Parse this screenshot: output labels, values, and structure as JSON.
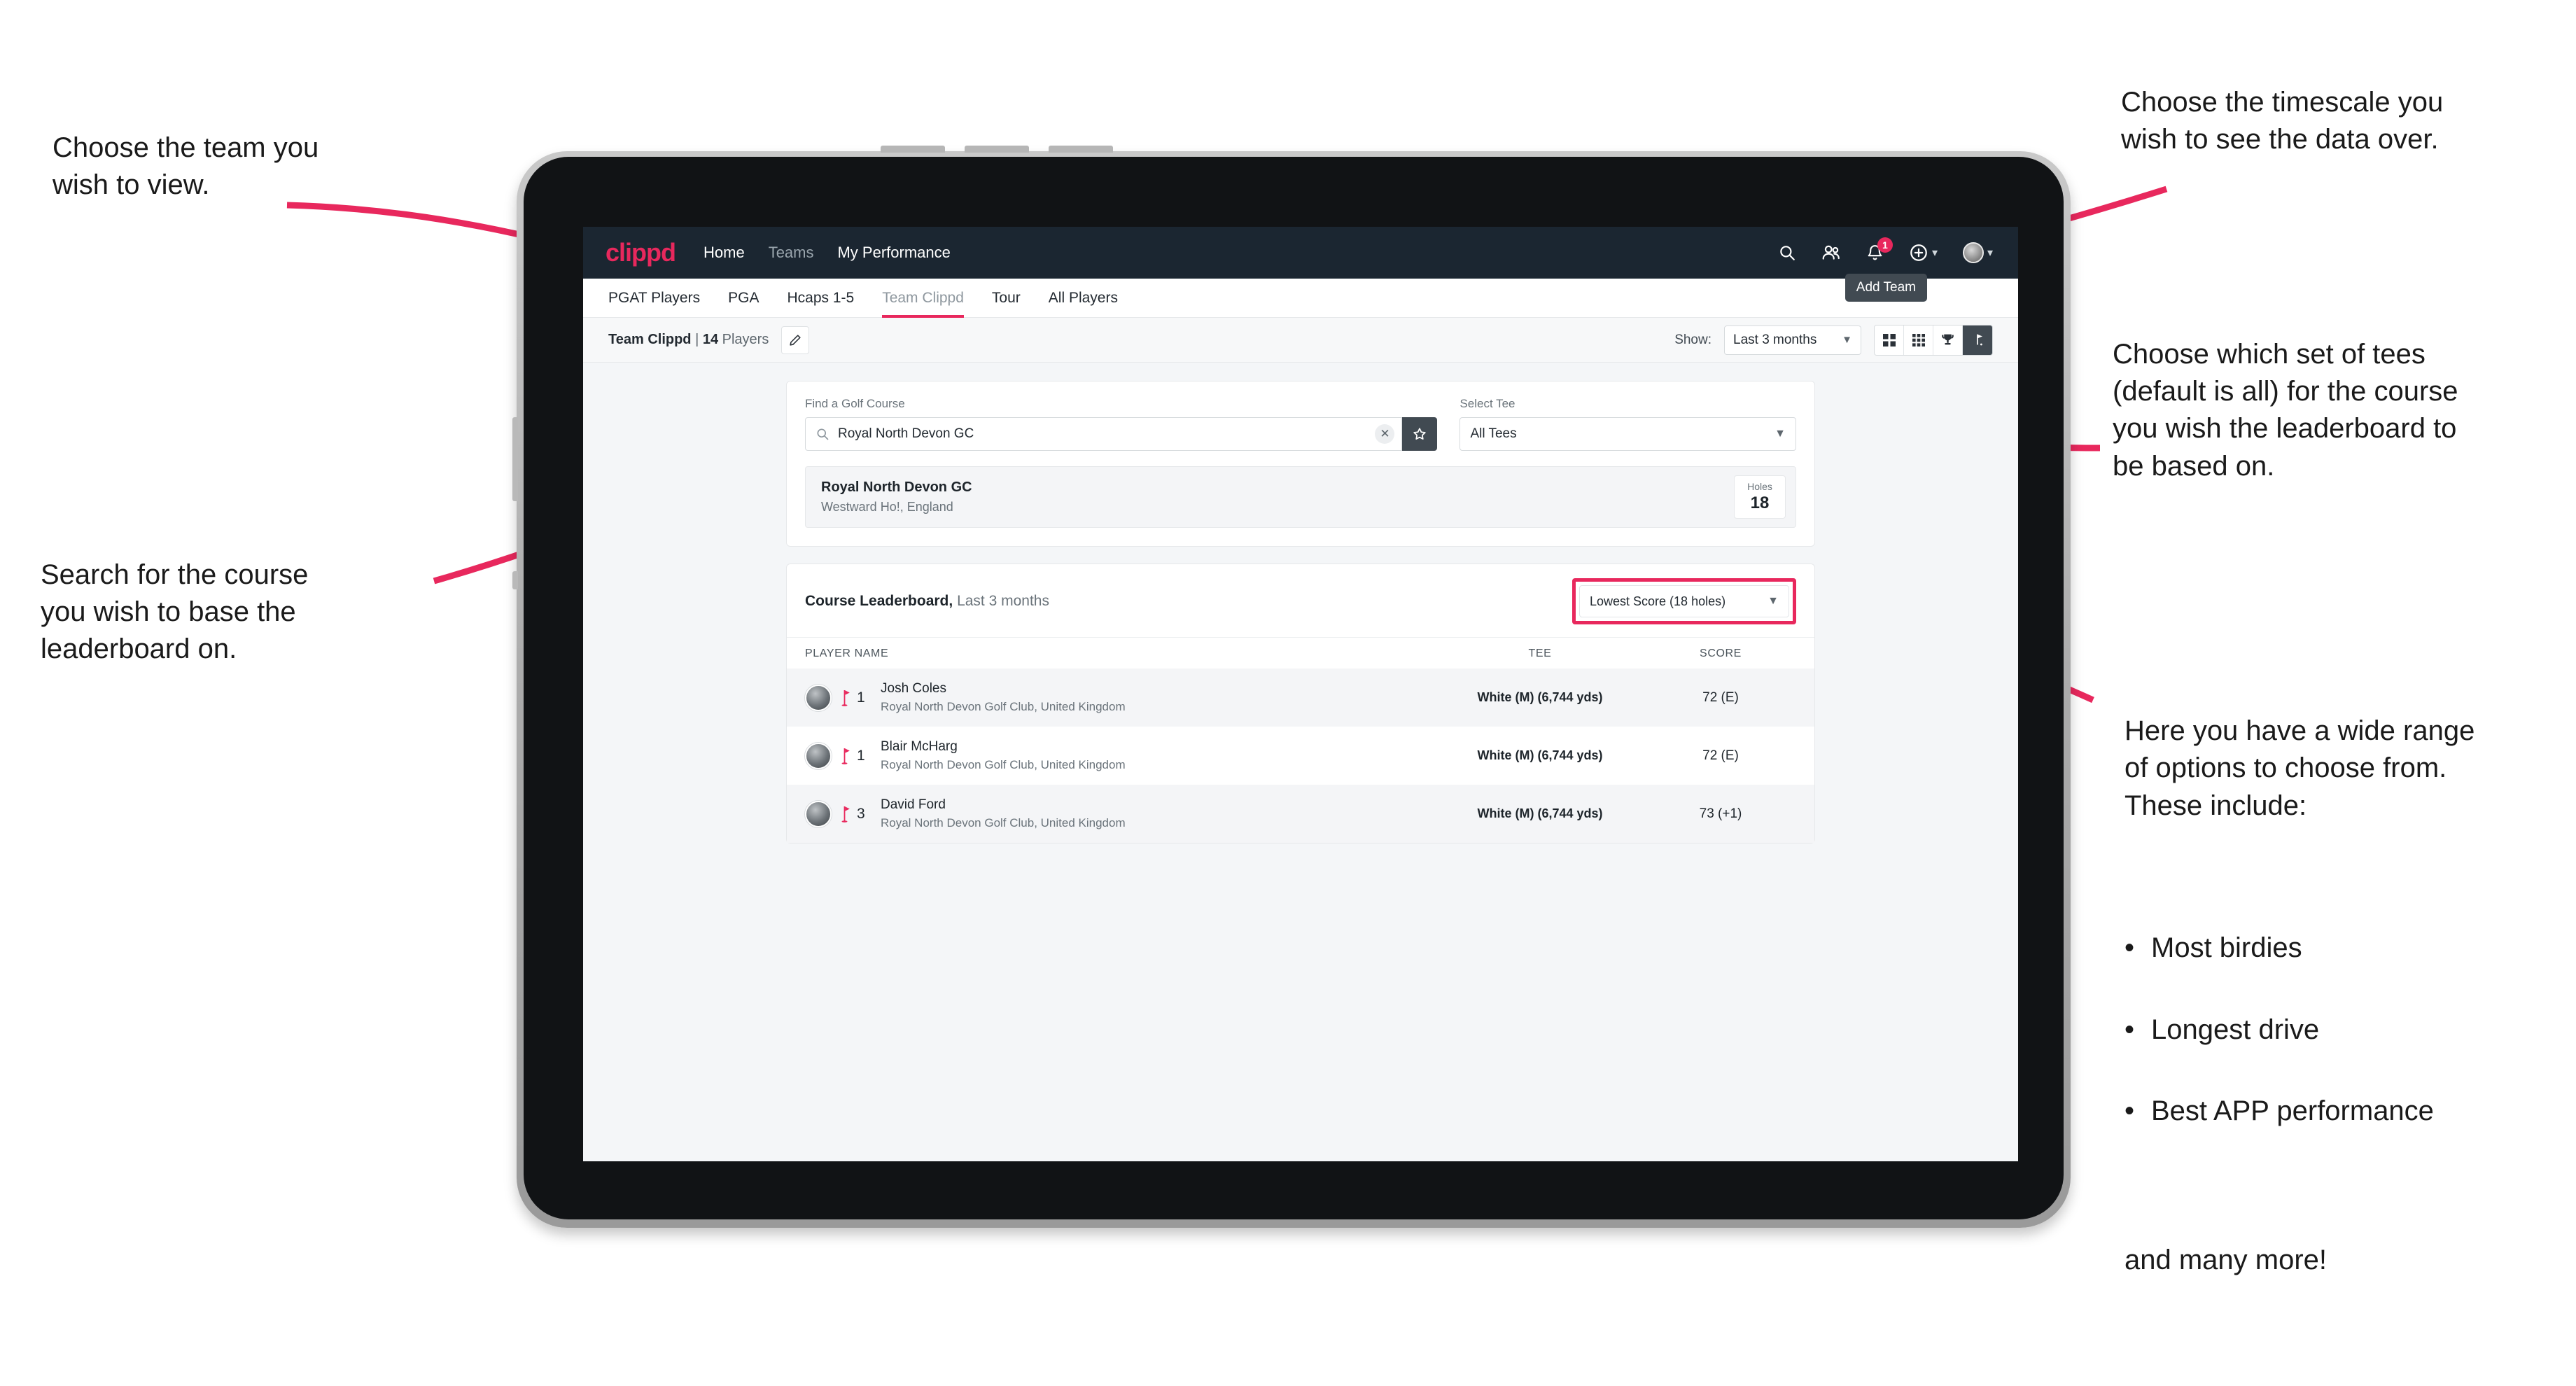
{
  "annotations": {
    "team": "Choose the team you\nwish to view.",
    "timescale": "Choose the timescale you\nwish to see the data over.",
    "tees": "Choose which set of tees\n(default is all) for the course\nyou wish the leaderboard to\nbe based on.",
    "search": "Search for the course\nyou wish to base the\nleaderboard on.",
    "options_intro": "Here you have a wide range\nof options to choose from.\nThese include:",
    "options_bullets": [
      "Most birdies",
      "Longest drive",
      "Best APP performance"
    ],
    "options_tail": "and many more!"
  },
  "topnav": {
    "brand": "clippd",
    "links": [
      {
        "label": "Home",
        "active": true
      },
      {
        "label": "Teams",
        "active": false
      },
      {
        "label": "My Performance",
        "active": true
      }
    ],
    "icons": {
      "search": "search-icon",
      "people": "people-icon",
      "bell": "bell-icon",
      "bell_badge": "1",
      "plus": "plus-circle-icon",
      "avatar": "avatar-icon"
    }
  },
  "tabs": [
    {
      "label": "PGAT Players",
      "state": "normal"
    },
    {
      "label": "PGA",
      "state": "normal"
    },
    {
      "label": "Hcaps 1-5",
      "state": "normal"
    },
    {
      "label": "Team Clippd",
      "state": "active"
    },
    {
      "label": "Tour",
      "state": "normal"
    },
    {
      "label": "All Players",
      "state": "normal"
    }
  ],
  "tooltip": {
    "add_team": "Add Team"
  },
  "subbar": {
    "team_name": "Team Clippd",
    "separator": " | ",
    "player_count": "14",
    "players_word": " Players",
    "edit_icon": "pencil-icon",
    "show_label": "Show:",
    "show_value": "Last 3 months",
    "view_buttons": [
      {
        "name": "grid-large-view-button",
        "active": false
      },
      {
        "name": "grid-small-view-button",
        "active": false
      },
      {
        "name": "trophy-view-button",
        "active": false
      },
      {
        "name": "course-view-button",
        "active": true
      }
    ]
  },
  "search_card": {
    "course_label": "Find a Golf Course",
    "course_value": "Royal North Devon GC",
    "course_placeholder": "Find a Golf Course",
    "clear_icon": "close-icon",
    "star_icon": "star-icon",
    "tee_label": "Select Tee",
    "tee_value": "All Tees"
  },
  "course_result": {
    "name": "Royal North Devon GC",
    "location": "Westward Ho!, England",
    "holes_label": "Holes",
    "holes_value": "18"
  },
  "leaderboard": {
    "title": "Course Leaderboard,",
    "subtitle": " Last 3 months",
    "metric_value": "Lowest Score (18 holes)",
    "columns": [
      "PLAYER NAME",
      "TEE",
      "SCORE"
    ],
    "rows": [
      {
        "rank": "1",
        "name": "Josh Coles",
        "club": "Royal North Devon Golf Club, United Kingdom",
        "tee": "White (M) (6,744 yds)",
        "score": "72 (E)"
      },
      {
        "rank": "1",
        "name": "Blair McHarg",
        "club": "Royal North Devon Golf Club, United Kingdom",
        "tee": "White (M) (6,744 yds)",
        "score": "72 (E)"
      },
      {
        "rank": "3",
        "name": "David Ford",
        "club": "Royal North Devon Golf Club, United Kingdom",
        "tee": "White (M) (6,744 yds)",
        "score": "73 (+1)"
      }
    ]
  },
  "colors": {
    "accent": "#e8285d",
    "nav_bg": "#1b2631",
    "dark_btn": "#414a52",
    "page_bg": "#f4f6f8"
  }
}
